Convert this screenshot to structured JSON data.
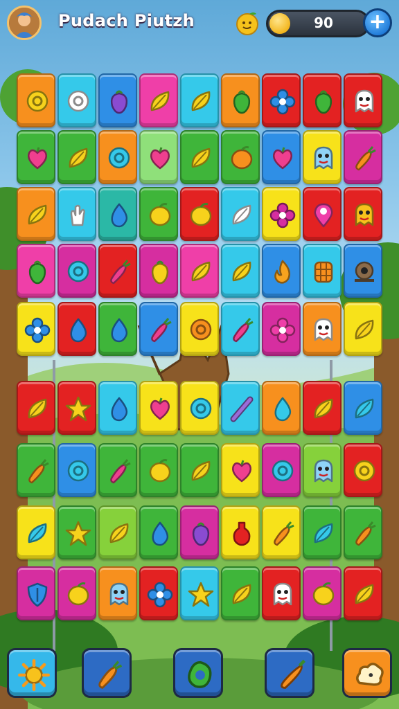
{
  "header": {
    "title": "Pudach Piutzh",
    "score": "90",
    "plus_symbol": "+"
  },
  "board": {
    "palette": {
      "orange": "#f7901e",
      "cyan": "#35c9ea",
      "blue": "#2f8fe6",
      "pink": "#ef3fa8",
      "red": "#e32222",
      "green": "#3fb53a",
      "yellow": "#f7e21a",
      "magenta": "#d62ea0",
      "teal": "#2bb8a6",
      "lime": "#86d13b",
      "ltgreen": "#8fe07a"
    },
    "rows": [
      [
        {
          "color": "orange",
          "icon": "spiral-icon"
        },
        {
          "color": "cyan",
          "icon": "bubble-icon"
        },
        {
          "color": "blue",
          "icon": "eggplant-icon"
        },
        {
          "color": "pink",
          "icon": "leaf-icon"
        },
        {
          "color": "cyan",
          "icon": "leaf-icon"
        },
        {
          "color": "orange",
          "icon": "pepper-icon"
        },
        {
          "color": "red",
          "icon": "flower-icon"
        },
        {
          "color": "red",
          "icon": "pepper-icon"
        },
        {
          "color": "red",
          "icon": "ghost-icon"
        }
      ],
      [
        {
          "color": "green",
          "icon": "heart-icon"
        },
        {
          "color": "green",
          "icon": "leaf-icon"
        },
        {
          "color": "orange",
          "icon": "bubble-icon"
        },
        {
          "color": "ltgreen",
          "icon": "apple-icon"
        },
        {
          "color": "green",
          "icon": "leaf-icon"
        },
        {
          "color": "green",
          "icon": "orange-icon"
        },
        {
          "color": "blue",
          "icon": "heart-icon"
        },
        {
          "color": "yellow",
          "icon": "monster-icon"
        },
        {
          "color": "magenta",
          "icon": "carrot-icon"
        }
      ],
      [
        {
          "color": "orange",
          "icon": "leaf-icon"
        },
        {
          "color": "cyan",
          "icon": "hand-icon"
        },
        {
          "color": "teal",
          "icon": "drop-icon"
        },
        {
          "color": "green",
          "icon": "mango-icon"
        },
        {
          "color": "red",
          "icon": "lemon-icon"
        },
        {
          "color": "cyan",
          "icon": "feather-icon"
        },
        {
          "color": "yellow",
          "icon": "cross-icon"
        },
        {
          "color": "red",
          "icon": "pin-icon"
        },
        {
          "color": "red",
          "icon": "robot-icon"
        }
      ],
      [
        {
          "color": "pink",
          "icon": "pepper-icon"
        },
        {
          "color": "magenta",
          "icon": "bubble-icon"
        },
        {
          "color": "red",
          "icon": "radish-icon"
        },
        {
          "color": "magenta",
          "icon": "strawberry-icon"
        },
        {
          "color": "pink",
          "icon": "leaf-icon"
        },
        {
          "color": "cyan",
          "icon": "leaf-icon"
        },
        {
          "color": "blue",
          "icon": "flame-icon"
        },
        {
          "color": "cyan",
          "icon": "waffle-icon"
        },
        {
          "color": "blue",
          "icon": "snail-icon"
        }
      ],
      [
        {
          "color": "yellow",
          "icon": "flower-icon"
        },
        {
          "color": "red",
          "icon": "drop-icon"
        },
        {
          "color": "green",
          "icon": "drop-icon"
        },
        {
          "color": "blue",
          "icon": "radish-icon"
        },
        {
          "color": "yellow",
          "icon": "donut-icon"
        },
        {
          "color": "cyan",
          "icon": "radish-icon"
        },
        {
          "color": "magenta",
          "icon": "squiggle-icon"
        },
        {
          "color": "orange",
          "icon": "ghost-icon"
        },
        {
          "color": "yellow",
          "icon": "leaf-icon"
        }
      ],
      [
        {
          "color": "red",
          "icon": "leaf-icon"
        },
        {
          "color": "red",
          "icon": "star-icon"
        },
        {
          "color": "cyan",
          "icon": "drop-icon"
        },
        {
          "color": "yellow",
          "icon": "apple-icon"
        },
        {
          "color": "yellow",
          "icon": "bubble-icon"
        },
        {
          "color": "cyan",
          "icon": "stick-icon"
        },
        {
          "color": "orange",
          "icon": "balloon-icon"
        },
        {
          "color": "red",
          "icon": "leaf-icon"
        },
        {
          "color": "blue",
          "icon": "feather-icon"
        }
      ],
      [
        {
          "color": "green",
          "icon": "carrot-icon"
        },
        {
          "color": "blue",
          "icon": "bubble-icon"
        },
        {
          "color": "green",
          "icon": "radish-icon"
        },
        {
          "color": "green",
          "icon": "mango-icon"
        },
        {
          "color": "green",
          "icon": "leaf-icon"
        },
        {
          "color": "yellow",
          "icon": "heart-icon"
        },
        {
          "color": "magenta",
          "icon": "ring-icon"
        },
        {
          "color": "lime",
          "icon": "monster-icon"
        },
        {
          "color": "red",
          "icon": "spiral-icon"
        }
      ],
      [
        {
          "color": "yellow",
          "icon": "feather-icon"
        },
        {
          "color": "green",
          "icon": "star-icon"
        },
        {
          "color": "lime",
          "icon": "leaf-icon"
        },
        {
          "color": "green",
          "icon": "drop-icon"
        },
        {
          "color": "magenta",
          "icon": "eggplant-icon"
        },
        {
          "color": "yellow",
          "icon": "potion-icon"
        },
        {
          "color": "yellow",
          "icon": "carrot-icon"
        },
        {
          "color": "green",
          "icon": "feather-icon"
        },
        {
          "color": "green",
          "icon": "carrot-icon"
        }
      ],
      [
        {
          "color": "magenta",
          "icon": "shield-icon"
        },
        {
          "color": "magenta",
          "icon": "lemon-icon"
        },
        {
          "color": "orange",
          "icon": "monster-icon"
        },
        {
          "color": "red",
          "icon": "flower-icon"
        },
        {
          "color": "cyan",
          "icon": "star-icon"
        },
        {
          "color": "green",
          "icon": "leaf-icon"
        },
        {
          "color": "red",
          "icon": "ghost-icon"
        },
        {
          "color": "magenta",
          "icon": "lemon-icon"
        },
        {
          "color": "red",
          "icon": "leaf-icon"
        }
      ]
    ]
  },
  "toolbar": [
    {
      "name": "sun-booster-button",
      "icon": "sun-icon",
      "color": "#35b8ea"
    },
    {
      "name": "carrot-booster-button",
      "icon": "carrot-icon",
      "color": "#2d6bc4"
    },
    {
      "name": "shuffle-booster-button",
      "icon": "shuffle-icon",
      "color": "#2d6bc4"
    },
    {
      "name": "pepper-booster-button",
      "icon": "chili-icon",
      "color": "#2d6bc4"
    },
    {
      "name": "hint-booster-button",
      "icon": "cloud-icon",
      "color": "#f7901e"
    }
  ]
}
